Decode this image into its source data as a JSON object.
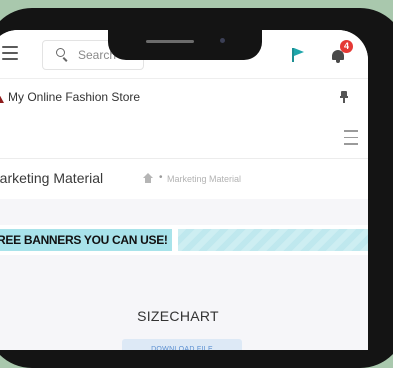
{
  "header": {
    "search_placeholder": "Search",
    "notification_count": "4"
  },
  "store": {
    "name": "My Online Fashion Store"
  },
  "page": {
    "title": "Marketing Material",
    "breadcrumb_separator": "•",
    "breadcrumb_current": "Marketing Material"
  },
  "content": {
    "banner_text": "FREE BANNERS YOU CAN USE!",
    "section_title": "SIZECHART",
    "download_label": "DOWNLOAD FILE"
  },
  "colors": {
    "background": "#a9c8ad",
    "accent_flag": "#1fa6ab",
    "badge": "#e53935",
    "banner_highlight": "#a8e3ea",
    "button_text": "#5b8fd1"
  },
  "icons": [
    "hamburger-icon",
    "search-icon",
    "flag-icon",
    "bell-icon",
    "store-logo",
    "pin-icon",
    "menu-icon",
    "home-icon"
  ]
}
